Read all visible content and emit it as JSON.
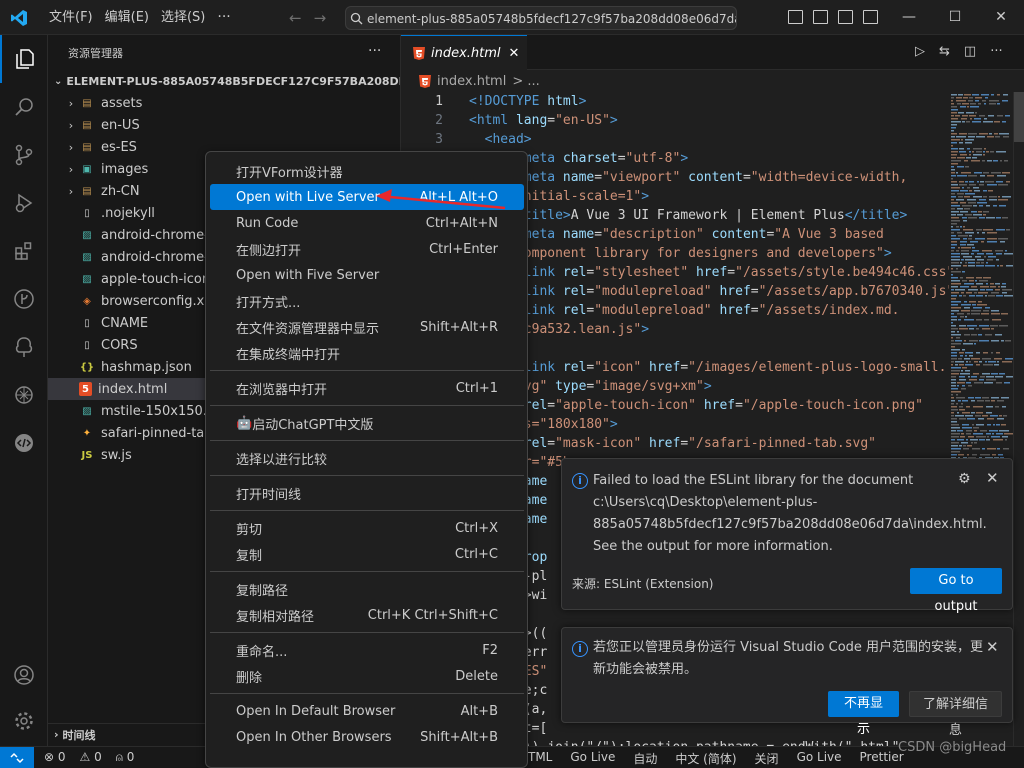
{
  "titlebar": {
    "menu": [
      "文件(F)",
      "编辑(E)",
      "选择(S)"
    ],
    "more": "···",
    "command_center": "element-plus-885a05748b5fdecf127c9f57ba208dd08e06d7da [管理员]",
    "window_controls": [
      "—",
      "☐",
      "✕"
    ]
  },
  "sidebar": {
    "title": "资源管理器",
    "more": "···",
    "root": "ELEMENT-PLUS-885A05748B5FDECF127C9F57BA208DD08E06...",
    "items": [
      {
        "label": "assets",
        "type": "folder",
        "icon": "folder-icon"
      },
      {
        "label": "en-US",
        "type": "folder",
        "icon": "folder-icon"
      },
      {
        "label": "es-ES",
        "type": "folder",
        "icon": "folder-icon"
      },
      {
        "label": "images",
        "type": "folder",
        "icon": "images-folder-icon"
      },
      {
        "label": "zh-CN",
        "type": "folder",
        "icon": "folder-icon"
      },
      {
        "label": ".nojekyll",
        "type": "file",
        "icon": "blank-file-icon"
      },
      {
        "label": "android-chrome-1",
        "type": "file",
        "icon": "image-file-icon"
      },
      {
        "label": "android-chrome-5",
        "type": "file",
        "icon": "image-file-icon"
      },
      {
        "label": "apple-touch-icon.",
        "type": "file",
        "icon": "image-file-icon"
      },
      {
        "label": "browserconfig.xm",
        "type": "file",
        "icon": "xml-file-icon"
      },
      {
        "label": "CNAME",
        "type": "file",
        "icon": "blank-file-icon"
      },
      {
        "label": "CORS",
        "type": "file",
        "icon": "blank-file-icon"
      },
      {
        "label": "hashmap.json",
        "type": "file",
        "icon": "json-file-icon"
      },
      {
        "label": "index.html",
        "type": "file",
        "icon": "html-file-icon",
        "selected": true
      },
      {
        "label": "mstile-150x150.pn",
        "type": "file",
        "icon": "image-file-icon"
      },
      {
        "label": "safari-pinned-tab.",
        "type": "file",
        "icon": "svg-file-icon"
      },
      {
        "label": "sw.js",
        "type": "file",
        "icon": "js-file-icon"
      }
    ],
    "timeline": "时间线"
  },
  "editor": {
    "tab_label": "index.html",
    "breadcrumb": "index.html",
    "breadcrumb_more": "> ...",
    "lines": [
      {
        "n": "1",
        "parts": [
          [
            "ctag",
            "<!DOCTYPE "
          ],
          [
            "catt",
            "html"
          ],
          [
            "ctag",
            ">"
          ]
        ]
      },
      {
        "n": "2",
        "parts": [
          [
            "ctag",
            "<html "
          ],
          [
            "catt",
            "lang"
          ],
          [
            "ctxt",
            "="
          ],
          [
            "cstr",
            "\"en-US\""
          ],
          [
            "ctag",
            ">"
          ]
        ]
      },
      {
        "n": "3",
        "parts": [
          [
            "ctag",
            "  <head>"
          ]
        ]
      },
      {
        "n": "",
        "parts": [
          [
            "ctag",
            "      <meta "
          ],
          [
            "catt",
            "charset"
          ],
          [
            "ctxt",
            "="
          ],
          [
            "cstr",
            "\"utf-8\""
          ],
          [
            "ctag",
            ">"
          ]
        ]
      },
      {
        "n": "",
        "parts": [
          [
            "ctag",
            "      <meta "
          ],
          [
            "catt",
            "name"
          ],
          [
            "ctxt",
            "="
          ],
          [
            "cstr",
            "\"viewport\" "
          ],
          [
            "catt",
            "content"
          ],
          [
            "ctxt",
            "="
          ],
          [
            "cstr",
            "\"width=device-width,"
          ]
        ]
      },
      {
        "n": "",
        "parts": [
          [
            "cstr",
            "      initial-scale=1\""
          ],
          [
            "ctag",
            ">"
          ]
        ]
      },
      {
        "n": "",
        "parts": [
          [
            "ctag",
            "      <title>"
          ],
          [
            "ctxt",
            "A Vue 3 UI Framework | Element Plus"
          ],
          [
            "ctag",
            "</title>"
          ]
        ]
      },
      {
        "n": "",
        "parts": [
          [
            "ctag",
            "      <meta "
          ],
          [
            "catt",
            "name"
          ],
          [
            "ctxt",
            "="
          ],
          [
            "cstr",
            "\"description\" "
          ],
          [
            "catt",
            "content"
          ],
          [
            "ctxt",
            "="
          ],
          [
            "cstr",
            "\"A Vue 3 based"
          ]
        ]
      },
      {
        "n": "",
        "parts": [
          [
            "cstr",
            "      component library for designers and developers\""
          ],
          [
            "ctag",
            ">"
          ]
        ]
      },
      {
        "n": "",
        "parts": [
          [
            "ctag",
            "      <link "
          ],
          [
            "catt",
            "rel"
          ],
          [
            "ctxt",
            "="
          ],
          [
            "cstr",
            "\"stylesheet\" "
          ],
          [
            "catt",
            "href"
          ],
          [
            "ctxt",
            "="
          ],
          [
            "cstr",
            "\"/assets/style.be494c46.css\""
          ],
          [
            "ctag",
            ">"
          ]
        ]
      },
      {
        "n": "",
        "parts": [
          [
            "ctag",
            "      <link "
          ],
          [
            "catt",
            "rel"
          ],
          [
            "ctxt",
            "="
          ],
          [
            "cstr",
            "\"modulepreload\" "
          ],
          [
            "catt",
            "href"
          ],
          [
            "ctxt",
            "="
          ],
          [
            "cstr",
            "\"/assets/app.b7670340.js\""
          ],
          [
            "ctag",
            ">"
          ]
        ]
      },
      {
        "n": "",
        "parts": [
          [
            "ctag",
            "      <link "
          ],
          [
            "catt",
            "rel"
          ],
          [
            "ctxt",
            "="
          ],
          [
            "cstr",
            "\"modulepreload\" "
          ],
          [
            "catt",
            "href"
          ],
          [
            "ctxt",
            "="
          ],
          [
            "cstr",
            "\"/assets/index.md."
          ]
        ]
      },
      {
        "n": "",
        "parts": [
          [
            "cstr",
            "      6c9a532.lean.js\""
          ],
          [
            "ctag",
            ">"
          ]
        ]
      },
      {
        "n": "",
        "parts": []
      },
      {
        "n": "",
        "parts": [
          [
            "ctag",
            "      <link "
          ],
          [
            "catt",
            "rel"
          ],
          [
            "ctxt",
            "="
          ],
          [
            "cstr",
            "\"icon\" "
          ],
          [
            "catt",
            "href"
          ],
          [
            "ctxt",
            "="
          ],
          [
            "cstr",
            "\"/images/element-plus-logo-small."
          ]
        ]
      },
      {
        "n": "",
        "parts": [
          [
            "cstr",
            "      svg\" "
          ],
          [
            "catt",
            "type"
          ],
          [
            "ctxt",
            "="
          ],
          [
            "cstr",
            "\"image/svg+xm\""
          ],
          [
            "ctag",
            ">"
          ]
        ]
      },
      {
        "n": "",
        "parts": [
          [
            "ctag",
            "      <"
          ],
          [
            "catt",
            "rel"
          ],
          [
            "ctxt",
            "="
          ],
          [
            "cstr",
            "\"apple-touch-icon\" "
          ],
          [
            "catt",
            "href"
          ],
          [
            "ctxt",
            "="
          ],
          [
            "cstr",
            "\"/apple-touch-icon.png\""
          ]
        ]
      },
      {
        "n": "",
        "parts": [
          [
            "cstr",
            "      es=\"180x180\""
          ],
          [
            "ctag",
            ">"
          ]
        ]
      },
      {
        "n": "",
        "parts": [
          [
            "ctag",
            "      <"
          ],
          [
            "catt",
            "rel"
          ],
          [
            "ctxt",
            "="
          ],
          [
            "cstr",
            "\"mask-icon\" "
          ],
          [
            "catt",
            "href"
          ],
          [
            "ctxt",
            "="
          ],
          [
            "cstr",
            "\"/safari-pinned-tab.svg\""
          ]
        ]
      },
      {
        "n": "",
        "parts": [
          [
            "cstr",
            "      or=\"#5b"
          ]
        ]
      },
      {
        "n": "",
        "parts": [
          [
            "catt",
            "      name"
          ]
        ]
      },
      {
        "n": "",
        "parts": [
          [
            "catt",
            "      name"
          ]
        ]
      },
      {
        "n": "",
        "parts": [
          [
            "catt",
            "      name"
          ]
        ]
      },
      {
        "n": "",
        "parts": []
      },
      {
        "n": "",
        "parts": [
          [
            "catt",
            "      prop"
          ]
        ]
      },
      {
        "n": "",
        "parts": [
          [
            "ctxt",
            "      t-pl"
          ]
        ]
      },
      {
        "n": "",
        "parts": [
          [
            "ctxt",
            "      t>wi"
          ]
        ]
      },
      {
        "n": "",
        "parts": [
          [
            "ctxt",
            "      >"
          ]
        ]
      },
      {
        "n": "",
        "parts": [
          [
            "ctxt",
            "      t>(("
          ]
        ]
      },
      {
        "n": "",
        "parts": [
          [
            "ctxt",
            "      ferr"
          ]
        ]
      },
      {
        "n": "",
        "parts": [
          [
            "cstr",
            "      -ES\""
          ]
        ]
      },
      {
        "n": "",
        "parts": [
          [
            "ctxt",
            "      ge;c"
          ]
        ]
      },
      {
        "n": "",
        "parts": [
          [
            "ctxt",
            "      m(a,"
          ]
        ]
      },
      {
        "n": "",
        "parts": [
          [
            "ctxt",
            "       t=["
          ]
        ]
      },
      {
        "n": "",
        "parts": [
          [
            "ctxt",
            "      \")).join(\"/\");location.pathname = endWith(\".html\""
          ]
        ]
      }
    ]
  },
  "context_menu": {
    "groups": [
      [
        {
          "label": "打开VForm设计器",
          "shortcut": ""
        },
        {
          "label": "Open with Live Server",
          "shortcut": "Alt+L Alt+O",
          "highlight": true
        },
        {
          "label": "Run Code",
          "shortcut": "Ctrl+Alt+N"
        },
        {
          "label": "在侧边打开",
          "shortcut": "Ctrl+Enter"
        },
        {
          "label": "Open with Five Server",
          "shortcut": ""
        },
        {
          "label": "打开方式...",
          "shortcut": ""
        },
        {
          "label": "在文件资源管理器中显示",
          "shortcut": "Shift+Alt+R"
        },
        {
          "label": "在集成终端中打开",
          "shortcut": ""
        }
      ],
      [
        {
          "label": "在浏览器中打开",
          "shortcut": "Ctrl+1"
        }
      ],
      [
        {
          "label": "启动ChatGPT中文版",
          "shortcut": "",
          "icon": true
        }
      ],
      [
        {
          "label": "选择以进行比较",
          "shortcut": ""
        }
      ],
      [
        {
          "label": "打开时间线",
          "shortcut": ""
        }
      ],
      [
        {
          "label": "剪切",
          "shortcut": "Ctrl+X"
        },
        {
          "label": "复制",
          "shortcut": "Ctrl+C"
        }
      ],
      [
        {
          "label": "复制路径",
          "shortcut": ""
        },
        {
          "label": "复制相对路径",
          "shortcut": "Ctrl+K Ctrl+Shift+C"
        }
      ],
      [
        {
          "label": "重命名...",
          "shortcut": "F2"
        },
        {
          "label": "删除",
          "shortcut": "Delete"
        }
      ],
      [
        {
          "label": "Open In Default Browser",
          "shortcut": "Alt+B"
        },
        {
          "label": "Open In Other Browsers",
          "shortcut": "Shift+Alt+B"
        }
      ]
    ]
  },
  "notifications": {
    "eslint": {
      "lines": [
        "Failed to load the ESLint library for the document",
        "c:\\Users\\cq\\Desktop\\element-plus-",
        "885a05748b5fdecf127c9f57ba208dd08e06d7da\\index.html.",
        "See the output for more information."
      ],
      "source": "来源: ESLint (Extension)",
      "button": "Go to output"
    },
    "admin": {
      "lines": [
        "若您正以管理员身份运行 Visual Studio Code 用户范围的安装，更",
        "新功能会被禁用。"
      ],
      "primary": "不再显示",
      "secondary": "了解详细信息"
    }
  },
  "statusbar": {
    "errors": "⊗ 0",
    "warnings": "⚠ 0",
    "ports": "0",
    "right": [
      "TML",
      "Go Live",
      "自动",
      "中文 (简体)",
      "关闭",
      "Go Live",
      "Prettier"
    ]
  },
  "watermark": "CSDN @bigHead",
  "colors": {
    "accent": "#0078d4",
    "background": "#1f1f1f",
    "sidebar": "#181818"
  }
}
